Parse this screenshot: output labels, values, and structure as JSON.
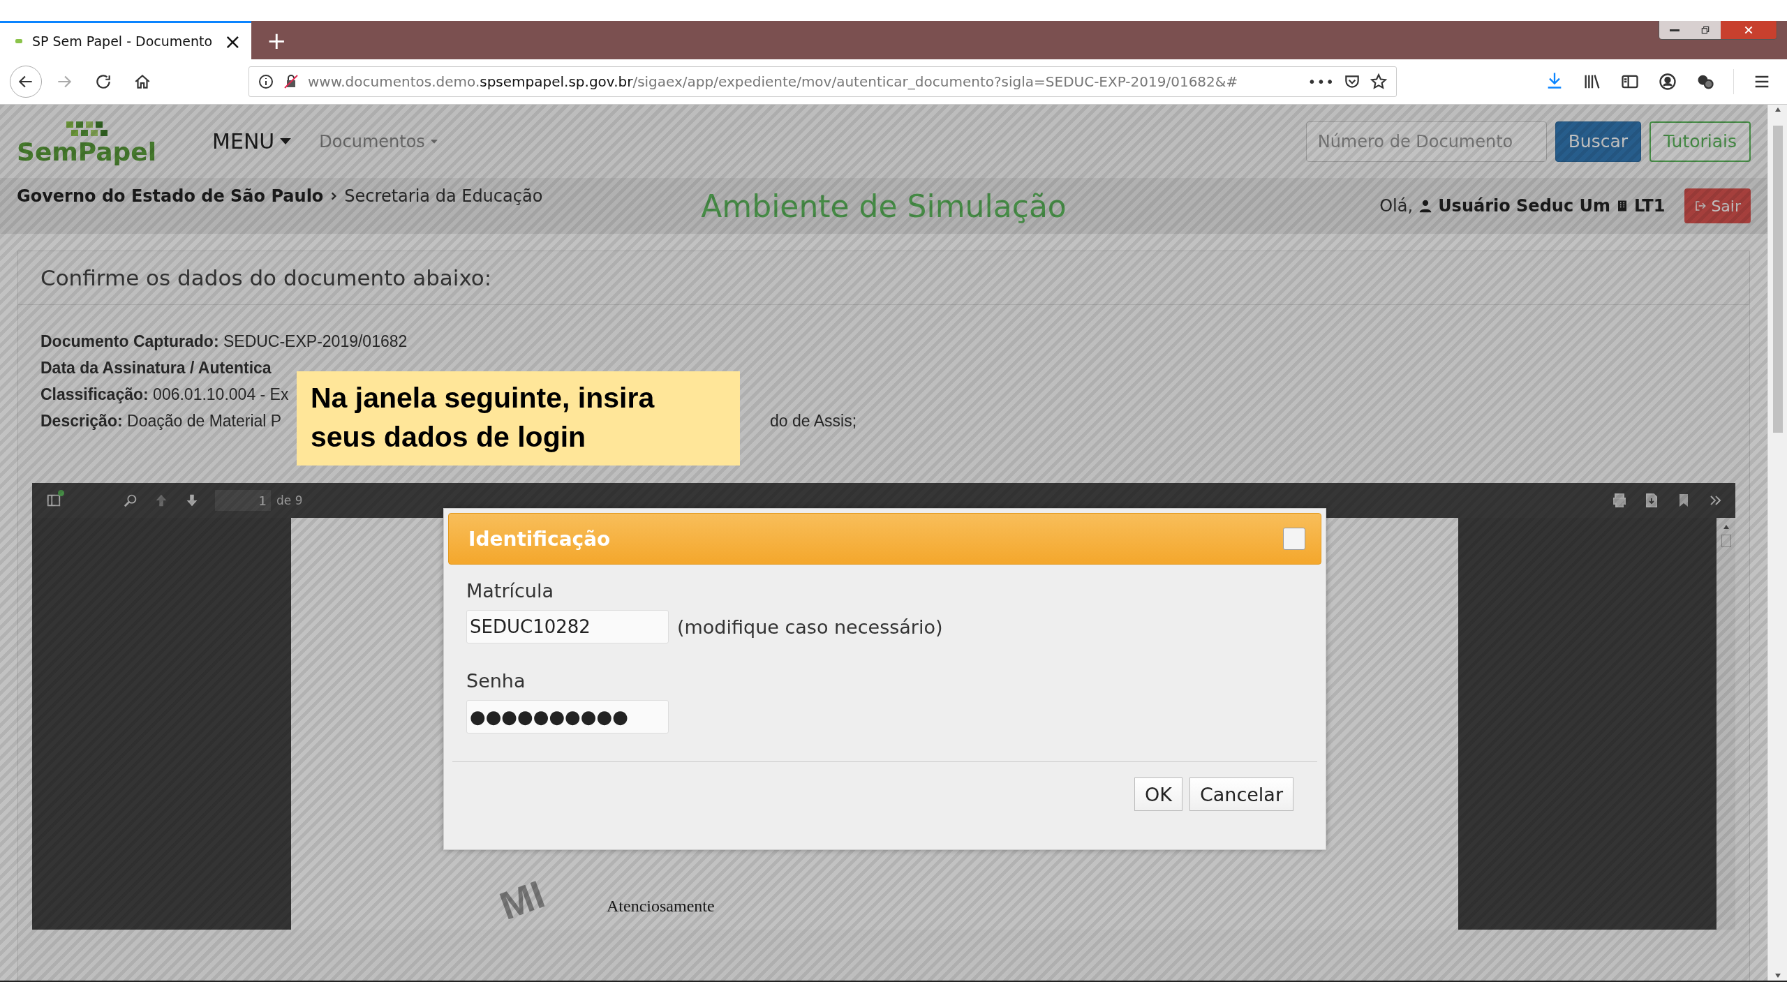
{
  "browser": {
    "tab": {
      "title": "SP Sem Papel - Documento",
      "close": "×",
      "selected": true
    },
    "new_tab": "+",
    "url": {
      "prefix": "www.documentos.demo.",
      "domain": "spsempapel.sp.gov.br",
      "path": "/sigaex/app/expediente/mov/autenticar_documento?sigla=SEDUC-EXP-2019/01682&#"
    },
    "page_actions": "•••"
  },
  "header": {
    "logo": "SemPapel",
    "menu": "MENU",
    "documents": "Documentos",
    "search": {
      "placeholder": "Número de Documento"
    },
    "buttons": [
      {
        "label": "Buscar",
        "kind": "primary"
      },
      {
        "label": "Tutoriais",
        "kind": "outline"
      }
    ]
  },
  "breadcrumb": {
    "root": "Governo do Estado de São Paulo",
    "current": "Secretaria da Educação"
  },
  "environment": "Ambiente de Simulação",
  "user": {
    "greeting": "Olá,",
    "name": "Usuário Seduc Um",
    "unit": "LT1",
    "logout": "Sair"
  },
  "panel": {
    "heading": "Confirme os dados do documento abaixo:",
    "fields": [
      {
        "label": "Documento Capturado:",
        "value": "SEDUC-EXP-2019/01682"
      },
      {
        "label": "Data da Assinatura / Autentica"
      },
      {
        "label": "Classificação:",
        "value": "006.01.10.004 - Ex"
      },
      {
        "label": "Descrição:",
        "value": "Doação de Material P",
        "tail": "do de Assis;"
      }
    ]
  },
  "viewer": {
    "page_number": "1",
    "page_count": "de 9",
    "page_text": "Atenciosamente",
    "watermark": "MI"
  },
  "callout": "Na janela seguinte, insira seus dados de login",
  "dialog": {
    "title": "Identificação",
    "fields": [
      {
        "label": "Matrícula",
        "value": "SEDUC10282",
        "hint": "(modifique caso necessário)"
      },
      {
        "label": "Senha",
        "value": "●●●●●●●●●●"
      }
    ],
    "buttons": [
      "OK",
      "Cancelar"
    ]
  }
}
